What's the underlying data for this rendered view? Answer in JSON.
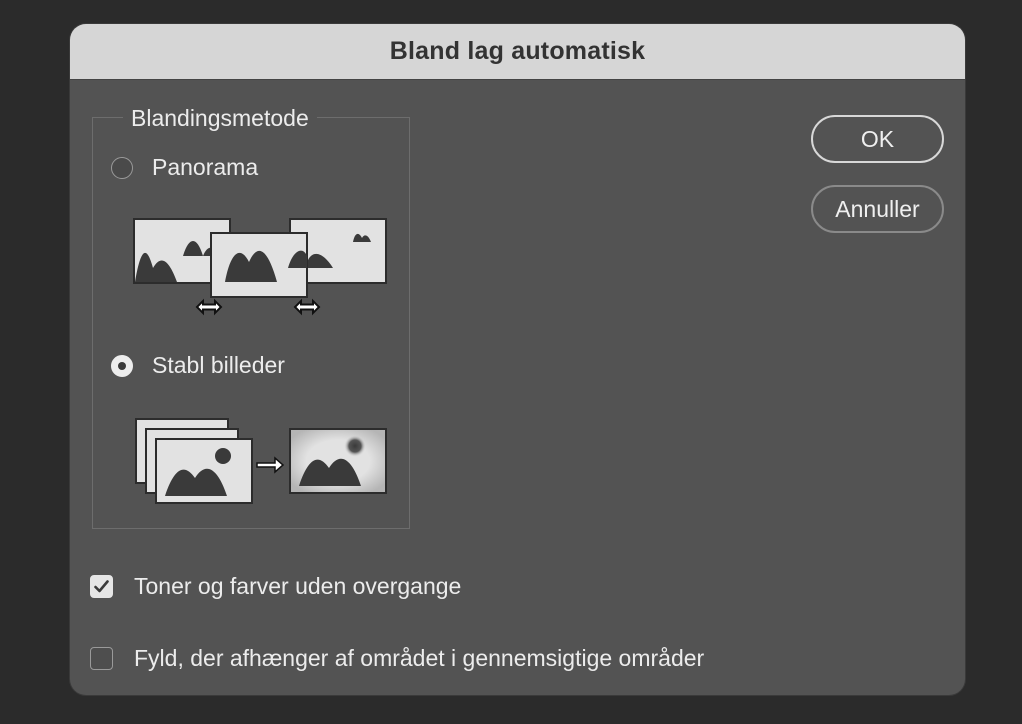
{
  "dialog": {
    "title": "Bland lag automatisk"
  },
  "blend_method": {
    "legend": "Blandingsmetode",
    "options": [
      {
        "label": "Panorama",
        "selected": false
      },
      {
        "label": "Stabl billeder",
        "selected": true
      }
    ]
  },
  "buttons": {
    "ok_label": "OK",
    "cancel_label": "Annuller"
  },
  "options": {
    "seamless_tones": {
      "label": "Toner og farver uden overgange",
      "checked": true
    },
    "content_aware_fill": {
      "label": "Fyld, der afhænger af området i gennemsigtige områder",
      "checked": false
    }
  },
  "icons": {
    "panorama": "panorama-illustration-icon",
    "stack": "stack-images-illustration-icon",
    "check": "checkmark-icon"
  }
}
